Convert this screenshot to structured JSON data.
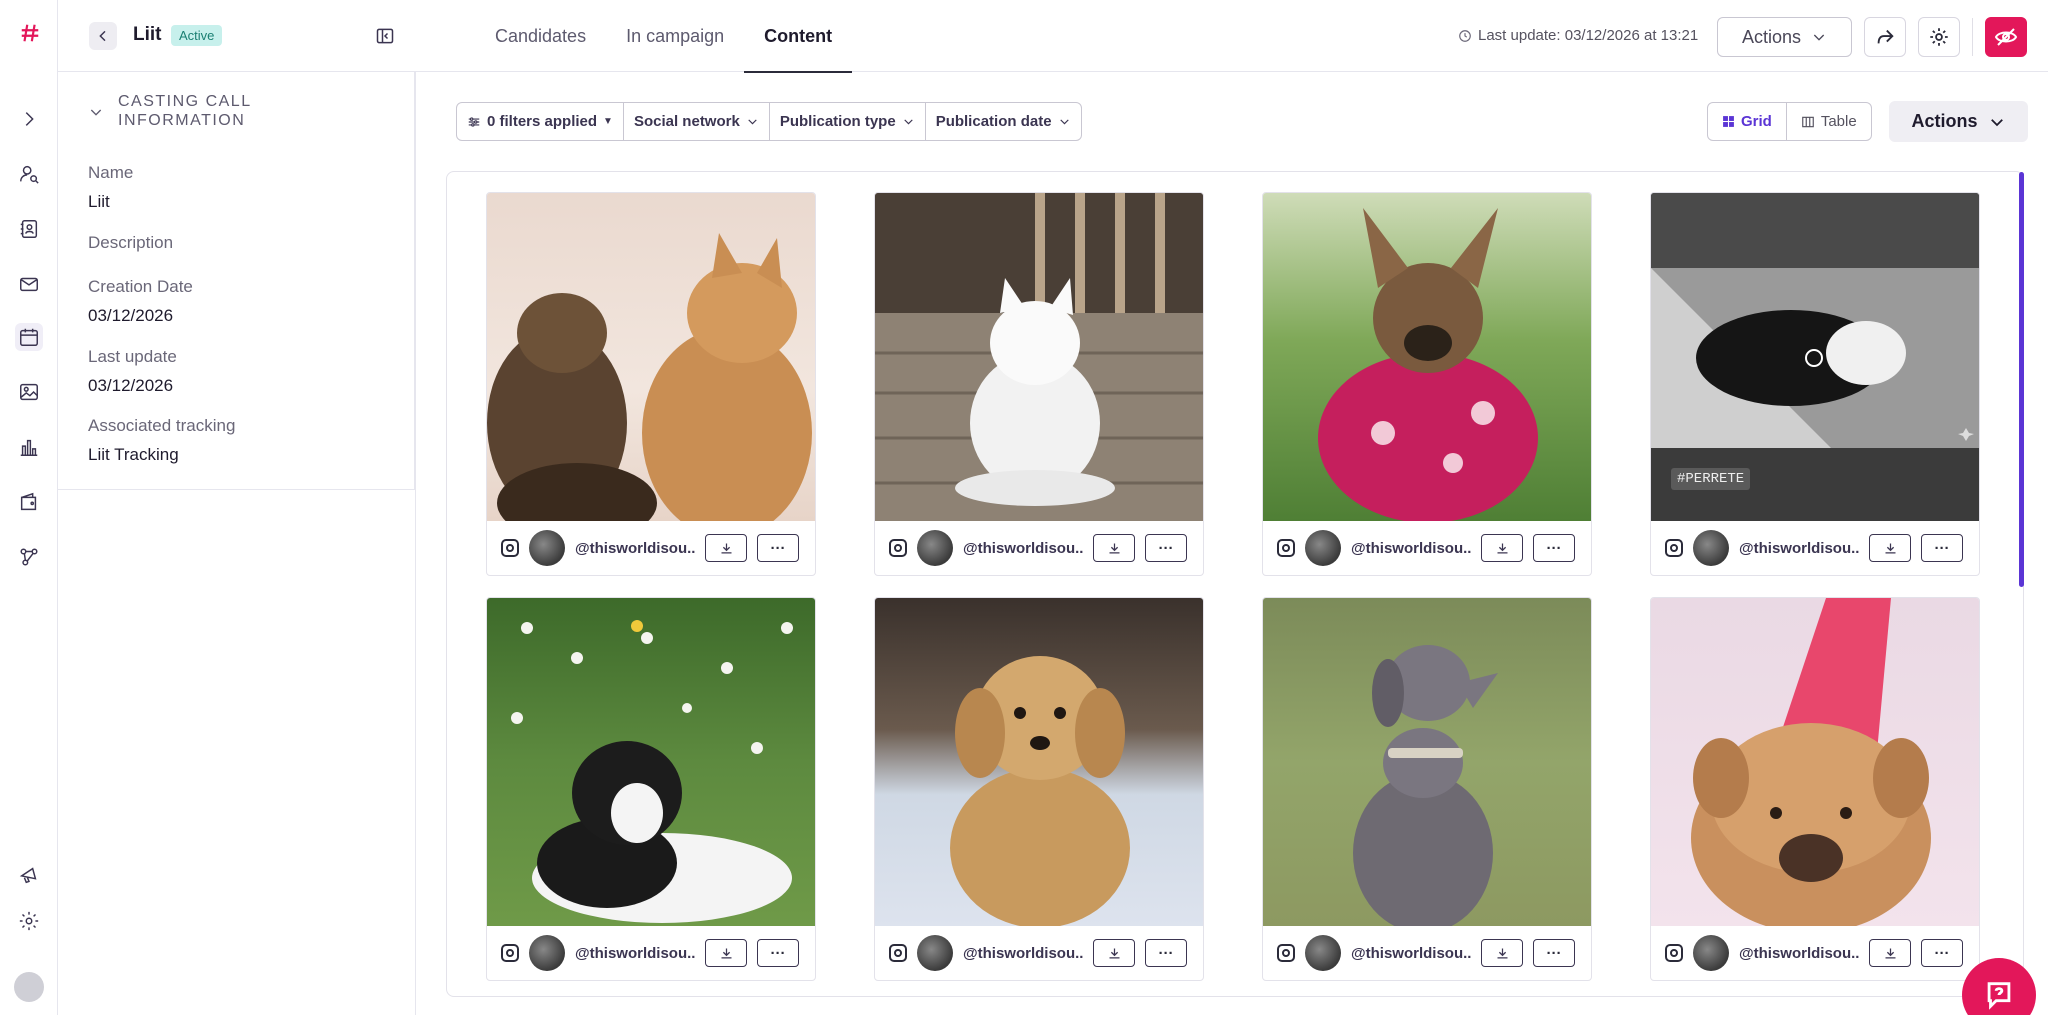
{
  "header": {
    "campaign_name": "Liit",
    "status": "Active",
    "tabs": [
      "Candidates",
      "In campaign",
      "Content"
    ],
    "active_tab": "Content",
    "last_update": "Last update: 03/12/2026 at 13:21",
    "actions_label": "Actions"
  },
  "info_panel": {
    "title": "CASTING CALL INFORMATION",
    "fields": [
      {
        "label": "Name",
        "value": "Liit"
      },
      {
        "label": "Description",
        "value": ""
      },
      {
        "label": "Creation Date",
        "value": "03/12/2026"
      },
      {
        "label": "Last update",
        "value": "03/12/2026"
      },
      {
        "label": "Associated tracking",
        "value": "Liit Tracking"
      }
    ]
  },
  "toolbar": {
    "filters": [
      "0 filters applied",
      "Social network",
      "Publication type",
      "Publication date"
    ],
    "view_grid": "Grid",
    "view_table": "Table",
    "actions_label": "Actions"
  },
  "cards": [
    {
      "handle": "@thisworldisou...",
      "image": "dogs-howling"
    },
    {
      "handle": "@thisworldisou...",
      "image": "white-spitz-on-deck"
    },
    {
      "handle": "@thisworldisou...",
      "image": "dog-pink-sweater"
    },
    {
      "handle": "@thisworldisou...",
      "image": "sleeping-puppy-bw",
      "tag": "#PERRETE"
    },
    {
      "handle": "@thisworldisou...",
      "image": "border-collie-puppy-flowers"
    },
    {
      "handle": "@thisworldisou...",
      "image": "fluffy-puppy"
    },
    {
      "handle": "@thisworldisou...",
      "image": "weimaraner-grass"
    },
    {
      "handle": "@thisworldisou...",
      "image": "shar-pei-party-hat"
    }
  ],
  "colors": {
    "brand": "#e3175a",
    "accent": "#5b35d5",
    "badge_bg": "#c7f0ec",
    "badge_text": "#1a7f72"
  }
}
